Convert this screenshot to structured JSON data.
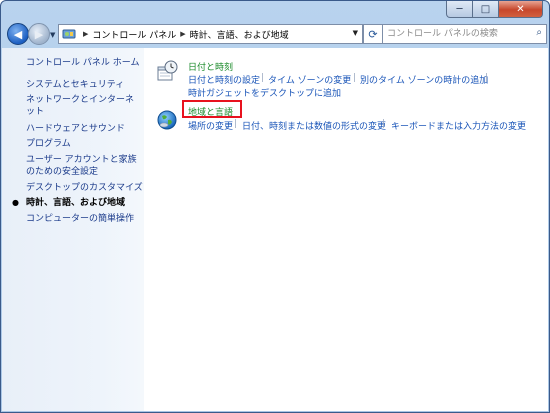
{
  "window": {
    "controls": {
      "minimize": "─",
      "maximize": "□",
      "close": "✕"
    }
  },
  "nav": {
    "back_icon": "back-arrow-icon",
    "forward_icon": "forward-arrow-icon",
    "breadcrumb": [
      "コントロール パネル",
      "時計、言語、および地域"
    ],
    "search_placeholder": "コントロール パネルの検索"
  },
  "sidebar": {
    "items": [
      {
        "label": "コントロール パネル ホーム",
        "current": false
      },
      {
        "label": "システムとセキュリティ",
        "current": false
      },
      {
        "label": "ネットワークとインターネット",
        "current": false
      },
      {
        "label": "ハードウェアとサウンド",
        "current": false
      },
      {
        "label": "プログラム",
        "current": false
      },
      {
        "label": "ユーザー アカウントと家族のための安全設定",
        "current": false
      },
      {
        "label": "デスクトップのカスタマイズ",
        "current": false
      },
      {
        "label": "時計、言語、および地域",
        "current": true
      },
      {
        "label": "コンピューターの簡単操作",
        "current": false
      }
    ]
  },
  "categories": [
    {
      "title": "日付と時刻",
      "icon": "clock-calendar-icon",
      "links": [
        "日付と時刻の設定",
        "タイム ゾーンの変更",
        "別のタイム ゾーンの時計の追加",
        "時計ガジェットをデスクトップに追加"
      ]
    },
    {
      "title": "地域と言語",
      "icon": "globe-icon",
      "links": [
        "場所の変更",
        "日付、時刻または数値の形式の変更",
        "キーボードまたは入力方法の変更"
      ]
    }
  ],
  "colors": {
    "link": "#1a55b8",
    "category_title": "#1a8a2a",
    "highlight": "#e8121e"
  }
}
